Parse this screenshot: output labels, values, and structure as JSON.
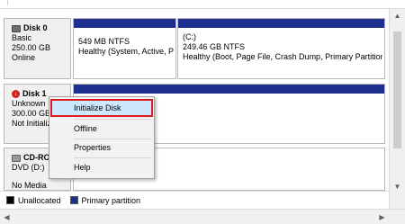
{
  "disks": [
    {
      "name": "Disk 0",
      "icon": "disk-icon",
      "lines": [
        "Basic",
        "250.00 GB",
        "Online"
      ],
      "partitions": [
        {
          "label": "",
          "size": "549 MB NTFS",
          "status": "Healthy (System, Active, Pri"
        },
        {
          "label": "(C:)",
          "size": "249.46 GB NTFS",
          "status": "Healthy (Boot, Page File, Crash Dump, Primary Partition"
        }
      ]
    },
    {
      "name": "Disk 1",
      "icon": "disk-error-icon",
      "lines": [
        "Unknown",
        "300.00 GB",
        "Not Initializ"
      ]
    },
    {
      "name": "CD-ROM",
      "icon": "cdrom-icon",
      "lines": [
        "DVD (D:)",
        "",
        "No Media"
      ]
    }
  ],
  "context_menu": {
    "items": [
      "Initialize Disk",
      "Offline",
      "Properties",
      "Help"
    ],
    "selected": "Initialize Disk"
  },
  "legend": [
    {
      "label": "Unallocated",
      "color": "#000000"
    },
    {
      "label": "Primary partition",
      "color": "#1e2f8f"
    }
  ],
  "colors": {
    "primary_partition": "#1e2f8f",
    "unallocated": "#000000",
    "selection_highlight": "#cce8ff",
    "selection_outline": "#e01b1b"
  }
}
